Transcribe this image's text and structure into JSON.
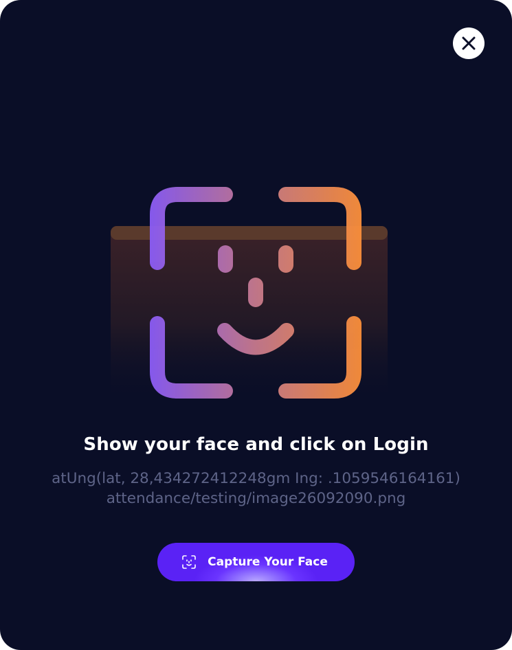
{
  "dialog": {
    "title": "Show your face and click on Login",
    "location_text": "atUng(lat, 28,434272412248gm Ing: .1059546164161)",
    "image_path_text": "attendance/testing/image26092090.png",
    "capture_button_label": "Capture Your Face",
    "close_icon": "close-icon",
    "illustration_icon": "face-scan-icon",
    "capture_button_icon": "face-scan-icon"
  },
  "colors": {
    "background": "#0a0e27",
    "accent_purple": "#8b5cf6",
    "accent_orange": "#fb923c",
    "button": "#6a34ff",
    "subtext": "#5e6488"
  }
}
